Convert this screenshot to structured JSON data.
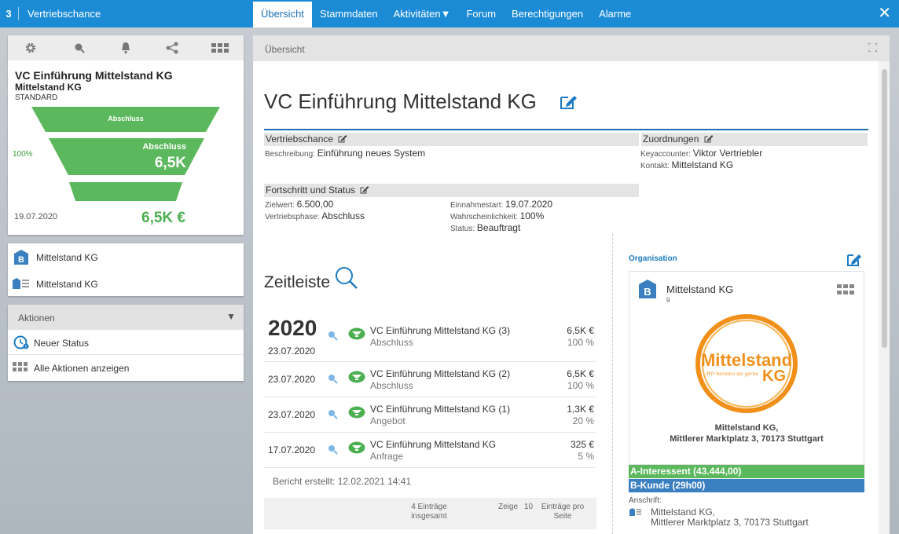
{
  "app": {
    "window_number": "3",
    "title": "Vertriebschance",
    "tabs": [
      {
        "label": "Übersicht"
      },
      {
        "label": "Stammdaten"
      },
      {
        "label": "Aktivitäten▼"
      },
      {
        "label": "Forum"
      },
      {
        "label": "Berechtigungen"
      },
      {
        "label": "Alarme"
      }
    ],
    "close_glyph": "✕"
  },
  "left": {
    "vc_title": "VC Einführung Mittelstand KG",
    "vc_company": "Mittelstand KG",
    "vc_type": "STANDARD",
    "funnel": {
      "top_label": "Abschluss",
      "mid_label": "Abschluss",
      "mid_value": "6,5K",
      "percent": "100%",
      "fill_color": "#5cb85c"
    },
    "date": "19.07.2020",
    "total": "6,5K €",
    "orgs": [
      {
        "label": "Mittelstand KG",
        "icon": "building-b-icon"
      },
      {
        "label": "Mittelstand KG",
        "icon": "address-card-icon"
      }
    ],
    "actions": {
      "header": "Aktionen",
      "items": [
        {
          "label": "Neuer Status",
          "icon": "new-status-icon"
        },
        {
          "label": "Alle Aktionen anzeigen",
          "icon": "grid-icon"
        }
      ]
    }
  },
  "main": {
    "header": "Übersicht",
    "title": "VC Einführung Mittelstand KG",
    "vertriebschance": {
      "header": "Vertriebschance",
      "beschreibung_label": "Beschreibung:",
      "beschreibung_value": "Einführung neues System"
    },
    "zuordnungen": {
      "header": "Zuordnungen",
      "keyaccounter_label": "Keyaccounter:",
      "keyaccounter_value": "Viktor Vertriebler",
      "kontakt_label": "Kontakt:",
      "kontakt_value": "Mittelstand KG"
    },
    "fortschritt": {
      "header": "Fortschritt und Status",
      "zielwert_label": "Zielwert:",
      "zielwert_value": "6.500,00",
      "phase_label": "Vertriebsphase:",
      "phase_value": "Abschluss",
      "einnahme_label": "Einnahmestart:",
      "einnahme_value": "19.07.2020",
      "wahrsch_label": "Wahrscheinlichkeit:",
      "wahrsch_value": "100%",
      "status_label": "Status:",
      "status_value": "Beauftragt"
    },
    "zeitleiste": {
      "title": "Zeitleiste",
      "year": "2020",
      "rows": [
        {
          "date": "23.07.2020",
          "title": "VC Einführung Mittelstand KG (3)",
          "phase": "Abschluss",
          "amount": "6,5K €",
          "percent": "100 %"
        },
        {
          "date": "23.07.2020",
          "title": "VC Einführung Mittelstand KG (2)",
          "phase": "Abschluss",
          "amount": "6,5K €",
          "percent": "100 %"
        },
        {
          "date": "23.07.2020",
          "title": "VC Einführung Mittelstand KG (1)",
          "phase": "Angebot",
          "amount": "1,3K €",
          "percent": "20 %"
        },
        {
          "date": "17.07.2020",
          "title": "VC Einführung Mittelstand KG",
          "phase": "Anfrage",
          "amount": "325 €",
          "percent": "5 %"
        }
      ],
      "bericht": "Bericht erstellt: 12.02.2021 14:41",
      "pager_total_line1": "4 Einträge",
      "pager_total_line2": "insgesamt",
      "pager_show": "Zeige",
      "pager_count": "10",
      "pager_per_line1": "Einträge pro",
      "pager_per_line2": "Seite"
    },
    "organisation": {
      "label": "Organisation",
      "name": "Mittelstand KG",
      "number": "9",
      "logo_line1": "Mittelstand",
      "logo_line2": "KG",
      "logo_tagline": "Wir beraten sie gerne",
      "address_line1": "Mittelstand KG,",
      "address_line2": "Mittlerer Marktplatz 3, 70173 Stuttgart",
      "badge_a": "A-Interessent (43.444,00)",
      "badge_b": "B-Kunde (29h00)",
      "badge_a_color": "#5cb85c",
      "badge_b_color": "#3a7fc0",
      "anschrift_label": "Anschrift:",
      "anschrift_line1": "Mittelstand KG,",
      "anschrift_line2": "Mittlerer Marktplatz 3, 70173 Stuttgart"
    }
  }
}
